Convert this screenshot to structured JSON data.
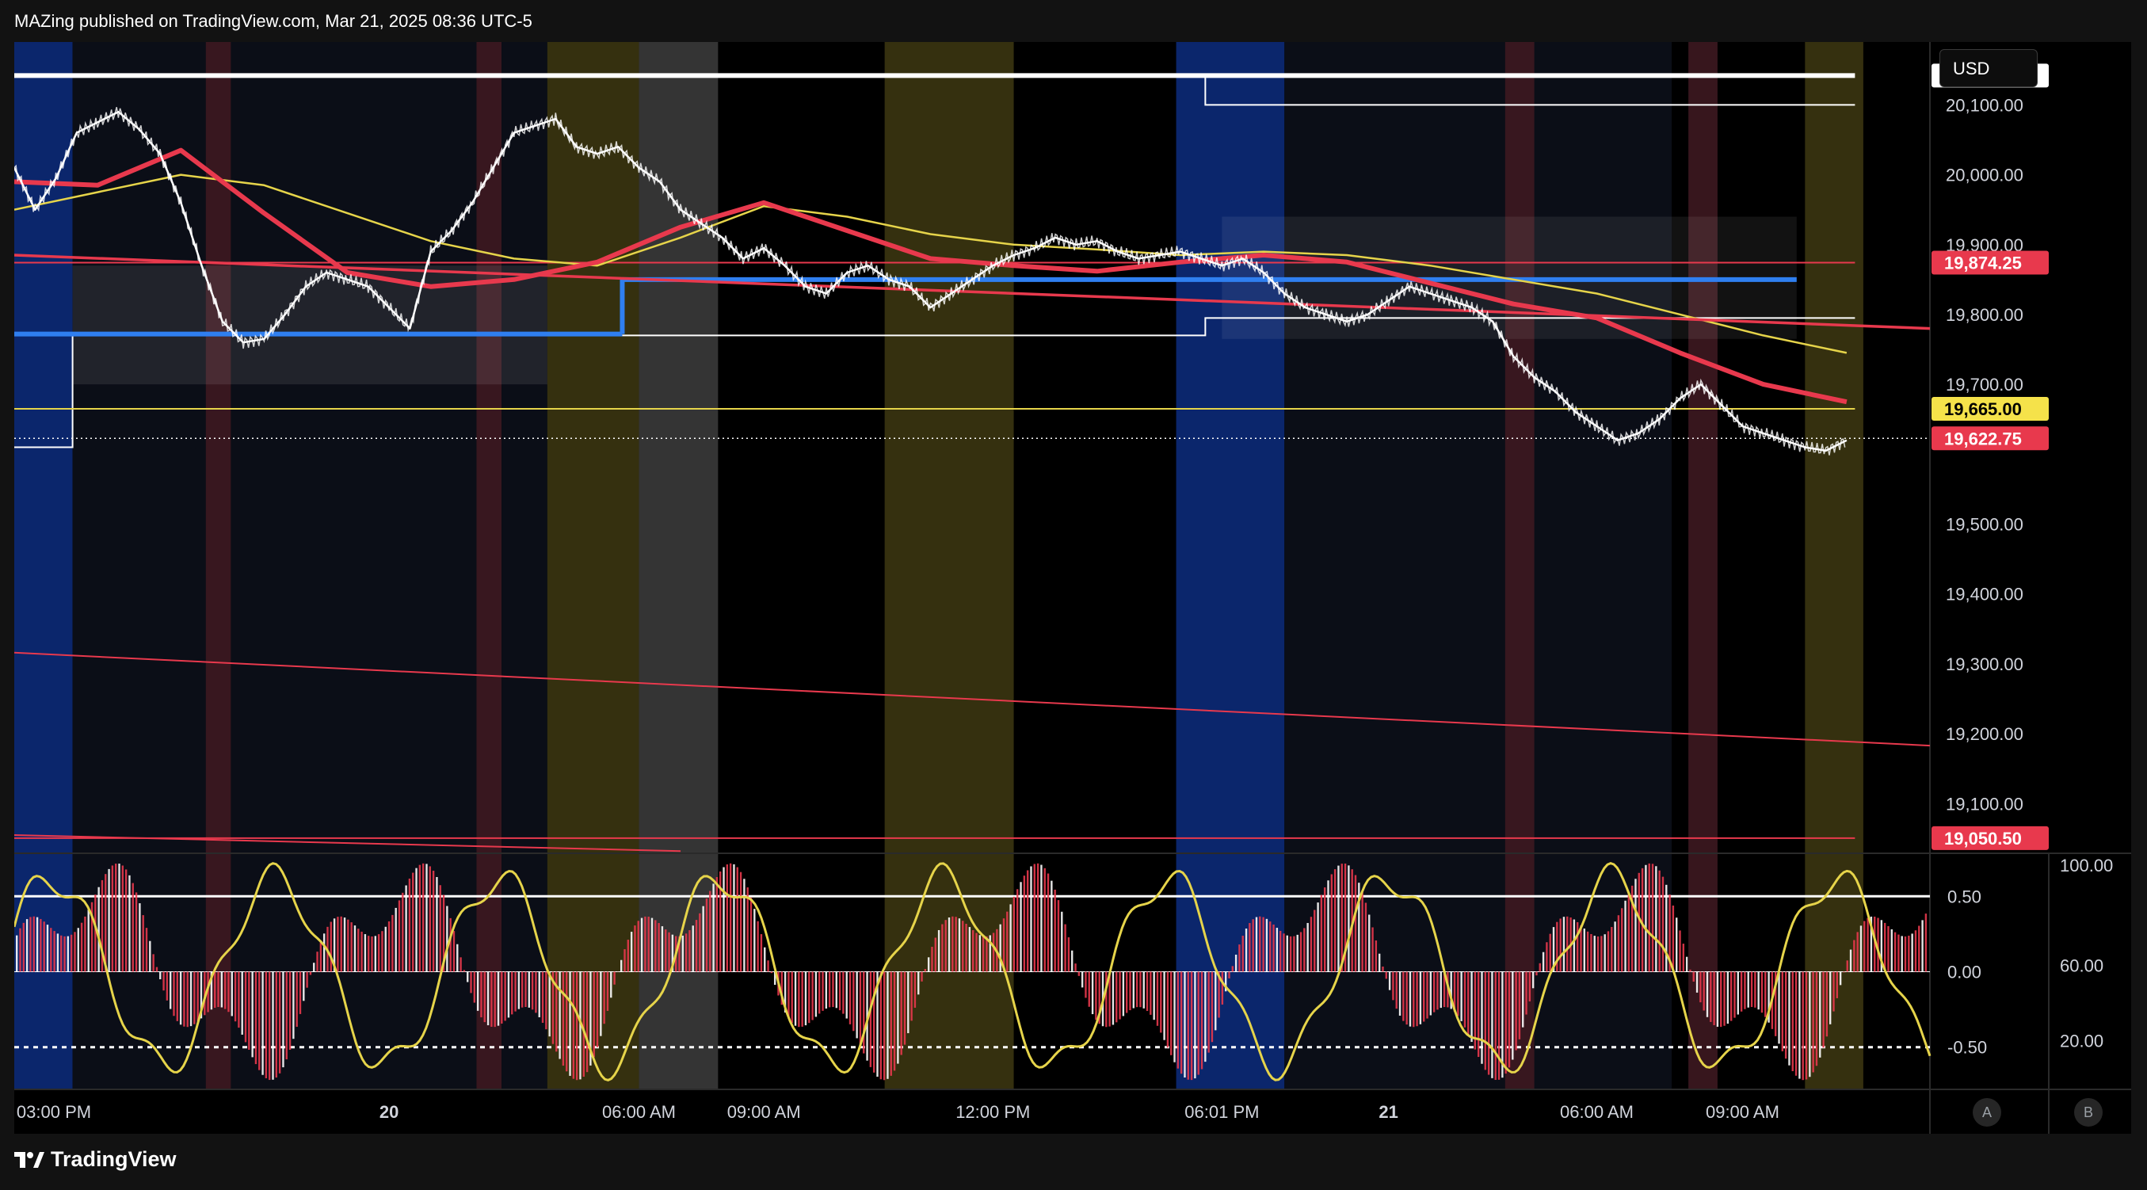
{
  "header": {
    "published": "MAZing published on TradingView.com, Mar 21, 2025 08:36 UTC-5"
  },
  "currency_button": "USD",
  "footer": {
    "logo_text": "TradingView"
  },
  "scale_buttons": {
    "auto": "A",
    "log": "B"
  },
  "colors": {
    "background": "#000000",
    "price_white": "#ffffff",
    "ma_red": "#e8394d",
    "ma_yellow": "#e6d44a",
    "ma_grey": "#9e9e9e",
    "level_blue": "#2f7ff0",
    "session_yellow": "#3b3511",
    "session_blue": "#0c2a78",
    "session_red": "#3d1820",
    "session_grey": "#3a3a3a"
  },
  "chart_data": [
    {
      "type": "line",
      "symbol_price_axis": {
        "ylim": [
          19030,
          20190
        ],
        "tick_labels": [
          "20,100.00",
          "20,000.00",
          "19,900.00",
          "19,800.00",
          "19,700.00",
          "19,500.00",
          "19,400.00",
          "19,300.00",
          "19,200.00",
          "19,100.00"
        ],
        "tick_values": [
          20100,
          20000,
          19900,
          19800,
          19700,
          19500,
          19400,
          19300,
          19200,
          19100
        ]
      },
      "x_axis": {
        "tick_labels": [
          "03:00 PM",
          "20",
          "06:00 AM",
          "09:00 AM",
          "12:00 PM",
          "06:01 PM",
          "21",
          "06:00 AM",
          "09:00 AM"
        ],
        "tick_positions_hours": [
          0,
          9,
          15,
          18,
          23.5,
          29,
          33,
          38,
          41.5
        ]
      },
      "price_tags": [
        {
          "label": "20,142.00",
          "value": 20142,
          "style": "white"
        },
        {
          "label": "19,874.25",
          "value": 19874.25,
          "style": "red"
        },
        {
          "label": "19,665.00",
          "value": 19665,
          "style": "yellow"
        },
        {
          "label": "19,622.75",
          "value": 19622.75,
          "style": "red"
        },
        {
          "label": "19,050.50",
          "value": 19050.5,
          "style": "red"
        }
      ],
      "horizontal_levels": [
        {
          "value": 20142,
          "color": "white",
          "from_hour": 0,
          "to_hour": 44.2
        },
        {
          "value": 19874.25,
          "color": "red",
          "from_hour": 0,
          "to_hour": 44.2
        },
        {
          "value": 19665,
          "color": "yellow",
          "from_hour": 0,
          "to_hour": 44.2
        },
        {
          "value": 19050.5,
          "color": "red",
          "from_hour": 0,
          "to_hour": 44.2
        },
        {
          "value": 19850,
          "color": "blue",
          "from_hour": 14.6,
          "to_hour": 42.8
        },
        {
          "value": 19772,
          "color": "blue",
          "from_hour": 0,
          "to_hour": 14.6
        }
      ],
      "series": [
        {
          "name": "Price",
          "x": [
            0,
            0.5,
            1,
            1.5,
            2,
            2.5,
            3,
            3.5,
            4,
            4.5,
            5,
            5.5,
            6,
            6.5,
            7,
            7.5,
            8,
            8.5,
            9,
            9.5,
            10,
            10.5,
            11,
            11.5,
            12,
            12.5,
            13,
            13.5,
            14,
            14.5,
            15,
            15.5,
            16,
            16.5,
            17,
            17.5,
            18,
            18.5,
            19,
            19.5,
            20,
            20.5,
            21,
            21.5,
            22,
            22.5,
            23,
            23.5,
            24,
            24.5,
            25,
            25.5,
            26,
            26.5,
            27,
            27.5,
            28,
            28.5,
            29,
            29.5,
            30,
            30.5,
            31,
            31.5,
            32,
            32.5,
            33,
            33.5,
            34,
            34.5,
            35,
            35.5,
            36,
            36.5,
            37,
            37.5,
            38,
            38.5,
            39,
            39.5,
            40,
            40.5,
            41,
            41.5,
            42,
            42.5,
            43,
            43.5,
            44
          ],
          "values": [
            20010,
            19950,
            19995,
            20060,
            20075,
            20090,
            20065,
            20030,
            19960,
            19870,
            19790,
            19760,
            19765,
            19800,
            19840,
            19860,
            19850,
            19840,
            19810,
            19780,
            19890,
            19920,
            19960,
            20010,
            20060,
            20070,
            20080,
            20040,
            20030,
            20040,
            20010,
            19990,
            19950,
            19930,
            19910,
            19880,
            19895,
            19870,
            19840,
            19830,
            19860,
            19870,
            19850,
            19840,
            19810,
            19830,
            19850,
            19870,
            19885,
            19895,
            19910,
            19900,
            19905,
            19890,
            19880,
            19885,
            19890,
            19880,
            19870,
            19880,
            19860,
            19830,
            19810,
            19800,
            19790,
            19800,
            19820,
            19840,
            19830,
            19820,
            19810,
            19790,
            19740,
            19710,
            19690,
            19660,
            19640,
            19620,
            19630,
            19650,
            19680,
            19700,
            19670,
            19640,
            19630,
            19620,
            19610,
            19605,
            19620
          ]
        },
        {
          "name": "MA red",
          "x": [
            0,
            2,
            4,
            6,
            8,
            10,
            12,
            14,
            16,
            18,
            20,
            22,
            24,
            26,
            28,
            30,
            32,
            34,
            36,
            38,
            40,
            42,
            44
          ],
          "values": [
            19990,
            19985,
            20035,
            19945,
            19860,
            19840,
            19850,
            19875,
            19925,
            19960,
            19920,
            19880,
            19870,
            19862,
            19875,
            19885,
            19875,
            19845,
            19815,
            19795,
            19745,
            19700,
            19675
          ]
        },
        {
          "name": "MA yellow",
          "x": [
            0,
            2,
            4,
            6,
            8,
            10,
            12,
            14,
            16,
            18,
            20,
            22,
            24,
            26,
            28,
            30,
            32,
            34,
            36,
            38,
            40,
            42,
            44
          ],
          "values": [
            19950,
            19975,
            20000,
            19985,
            19945,
            19905,
            19880,
            19870,
            19910,
            19955,
            19940,
            19915,
            19900,
            19893,
            19885,
            19890,
            19885,
            19870,
            19850,
            19830,
            19800,
            19770,
            19745
          ]
        },
        {
          "name": "Trend line red",
          "x": [
            0,
            46
          ],
          "values": [
            19885,
            19780
          ]
        }
      ]
    },
    {
      "type": "bar",
      "oscillator": {
        "right_axis_labels": [
          "0.50",
          "0.00",
          "-0.50"
        ],
        "right_axis_values": [
          0.5,
          0.0,
          -0.5
        ],
        "far_right_labels": [
          "100.00",
          "60.00",
          "20.00"
        ],
        "ylim": [
          -0.78,
          0.78
        ],
        "lines": [
          0.5,
          0.0,
          -0.5
        ]
      }
    }
  ]
}
